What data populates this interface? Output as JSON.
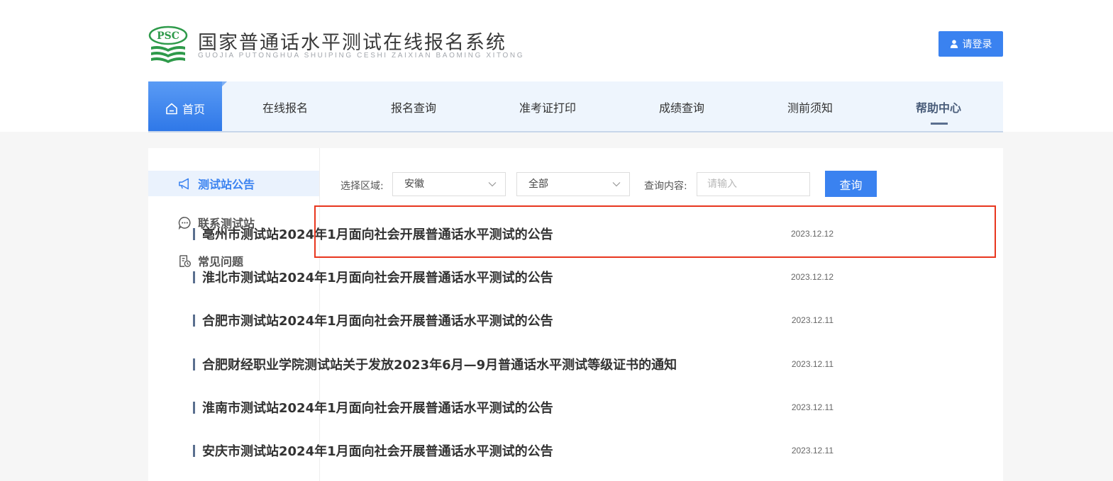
{
  "header": {
    "logo_text": "PSC",
    "title": "国家普通话水平测试在线报名系统",
    "subtitle": "GUOJIA PUTONGHUA SHUIPING CESHI ZAIXIAN BAOMING XITONG",
    "login_label": "请登录"
  },
  "nav": {
    "items": [
      {
        "label": "首页",
        "icon": "home-icon"
      },
      {
        "label": "在线报名"
      },
      {
        "label": "报名查询"
      },
      {
        "label": "准考证打印"
      },
      {
        "label": "成绩查询"
      },
      {
        "label": "测前须知"
      },
      {
        "label": "帮助中心"
      }
    ],
    "active": "帮助中心"
  },
  "sidebar": {
    "items": [
      {
        "label": "测试站公告",
        "icon": "megaphone-icon",
        "active": true
      },
      {
        "label": "联系测试站",
        "icon": "chat-bubble-icon"
      },
      {
        "label": "常见问题",
        "icon": "document-clock-icon"
      }
    ]
  },
  "filters": {
    "region_label": "选择区域:",
    "province": "安徽",
    "city": "全部",
    "query_label": "查询内容:",
    "query_placeholder": "请输入",
    "query_button": "查询"
  },
  "announcements": [
    {
      "title": "亳州市测试站2024年1月面向社会开展普通话水平测试的公告",
      "date": "2023.12.12",
      "highlighted": true
    },
    {
      "title": "淮北市测试站2024年1月面向社会开展普通话水平测试的公告",
      "date": "2023.12.12"
    },
    {
      "title": "合肥市测试站2024年1月面向社会开展普通话水平测试的公告",
      "date": "2023.12.11"
    },
    {
      "title": "合肥财经职业学院测试站关于发放2023年6月—9月普通话水平测试等级证书的通知",
      "date": "2023.12.11"
    },
    {
      "title": "淮南市测试站2024年1月面向社会开展普通话水平测试的公告",
      "date": "2023.12.11"
    },
    {
      "title": "安庆市测试站2024年1月面向社会开展普通话水平测试的公告",
      "date": "2023.12.11"
    }
  ],
  "colors": {
    "primary": "#3a82f0",
    "nav_background": "#eef5fd",
    "logo_green": "#2e9a4a",
    "highlight_border": "#e8361e"
  }
}
